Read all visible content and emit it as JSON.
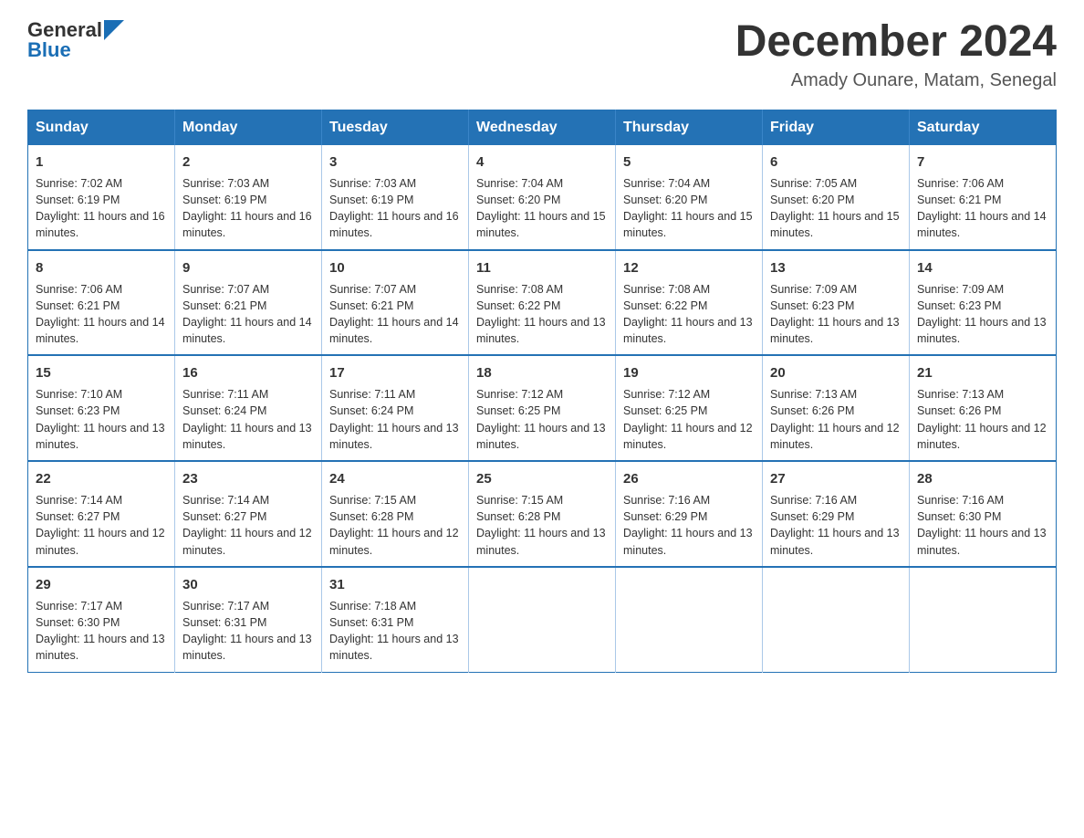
{
  "header": {
    "logo_general": "General",
    "logo_blue": "Blue",
    "month_title": "December 2024",
    "subtitle": "Amady Ounare, Matam, Senegal"
  },
  "days_of_week": [
    "Sunday",
    "Monday",
    "Tuesday",
    "Wednesday",
    "Thursday",
    "Friday",
    "Saturday"
  ],
  "weeks": [
    [
      {
        "day": "1",
        "sunrise": "7:02 AM",
        "sunset": "6:19 PM",
        "daylight": "11 hours and 16 minutes."
      },
      {
        "day": "2",
        "sunrise": "7:03 AM",
        "sunset": "6:19 PM",
        "daylight": "11 hours and 16 minutes."
      },
      {
        "day": "3",
        "sunrise": "7:03 AM",
        "sunset": "6:19 PM",
        "daylight": "11 hours and 16 minutes."
      },
      {
        "day": "4",
        "sunrise": "7:04 AM",
        "sunset": "6:20 PM",
        "daylight": "11 hours and 15 minutes."
      },
      {
        "day": "5",
        "sunrise": "7:04 AM",
        "sunset": "6:20 PM",
        "daylight": "11 hours and 15 minutes."
      },
      {
        "day": "6",
        "sunrise": "7:05 AM",
        "sunset": "6:20 PM",
        "daylight": "11 hours and 15 minutes."
      },
      {
        "day": "7",
        "sunrise": "7:06 AM",
        "sunset": "6:21 PM",
        "daylight": "11 hours and 14 minutes."
      }
    ],
    [
      {
        "day": "8",
        "sunrise": "7:06 AM",
        "sunset": "6:21 PM",
        "daylight": "11 hours and 14 minutes."
      },
      {
        "day": "9",
        "sunrise": "7:07 AM",
        "sunset": "6:21 PM",
        "daylight": "11 hours and 14 minutes."
      },
      {
        "day": "10",
        "sunrise": "7:07 AM",
        "sunset": "6:21 PM",
        "daylight": "11 hours and 14 minutes."
      },
      {
        "day": "11",
        "sunrise": "7:08 AM",
        "sunset": "6:22 PM",
        "daylight": "11 hours and 13 minutes."
      },
      {
        "day": "12",
        "sunrise": "7:08 AM",
        "sunset": "6:22 PM",
        "daylight": "11 hours and 13 minutes."
      },
      {
        "day": "13",
        "sunrise": "7:09 AM",
        "sunset": "6:23 PM",
        "daylight": "11 hours and 13 minutes."
      },
      {
        "day": "14",
        "sunrise": "7:09 AM",
        "sunset": "6:23 PM",
        "daylight": "11 hours and 13 minutes."
      }
    ],
    [
      {
        "day": "15",
        "sunrise": "7:10 AM",
        "sunset": "6:23 PM",
        "daylight": "11 hours and 13 minutes."
      },
      {
        "day": "16",
        "sunrise": "7:11 AM",
        "sunset": "6:24 PM",
        "daylight": "11 hours and 13 minutes."
      },
      {
        "day": "17",
        "sunrise": "7:11 AM",
        "sunset": "6:24 PM",
        "daylight": "11 hours and 13 minutes."
      },
      {
        "day": "18",
        "sunrise": "7:12 AM",
        "sunset": "6:25 PM",
        "daylight": "11 hours and 13 minutes."
      },
      {
        "day": "19",
        "sunrise": "7:12 AM",
        "sunset": "6:25 PM",
        "daylight": "11 hours and 12 minutes."
      },
      {
        "day": "20",
        "sunrise": "7:13 AM",
        "sunset": "6:26 PM",
        "daylight": "11 hours and 12 minutes."
      },
      {
        "day": "21",
        "sunrise": "7:13 AM",
        "sunset": "6:26 PM",
        "daylight": "11 hours and 12 minutes."
      }
    ],
    [
      {
        "day": "22",
        "sunrise": "7:14 AM",
        "sunset": "6:27 PM",
        "daylight": "11 hours and 12 minutes."
      },
      {
        "day": "23",
        "sunrise": "7:14 AM",
        "sunset": "6:27 PM",
        "daylight": "11 hours and 12 minutes."
      },
      {
        "day": "24",
        "sunrise": "7:15 AM",
        "sunset": "6:28 PM",
        "daylight": "11 hours and 12 minutes."
      },
      {
        "day": "25",
        "sunrise": "7:15 AM",
        "sunset": "6:28 PM",
        "daylight": "11 hours and 13 minutes."
      },
      {
        "day": "26",
        "sunrise": "7:16 AM",
        "sunset": "6:29 PM",
        "daylight": "11 hours and 13 minutes."
      },
      {
        "day": "27",
        "sunrise": "7:16 AM",
        "sunset": "6:29 PM",
        "daylight": "11 hours and 13 minutes."
      },
      {
        "day": "28",
        "sunrise": "7:16 AM",
        "sunset": "6:30 PM",
        "daylight": "11 hours and 13 minutes."
      }
    ],
    [
      {
        "day": "29",
        "sunrise": "7:17 AM",
        "sunset": "6:30 PM",
        "daylight": "11 hours and 13 minutes."
      },
      {
        "day": "30",
        "sunrise": "7:17 AM",
        "sunset": "6:31 PM",
        "daylight": "11 hours and 13 minutes."
      },
      {
        "day": "31",
        "sunrise": "7:18 AM",
        "sunset": "6:31 PM",
        "daylight": "11 hours and 13 minutes."
      },
      null,
      null,
      null,
      null
    ]
  ],
  "labels": {
    "sunrise_prefix": "Sunrise: ",
    "sunset_prefix": "Sunset: ",
    "daylight_prefix": "Daylight: "
  }
}
